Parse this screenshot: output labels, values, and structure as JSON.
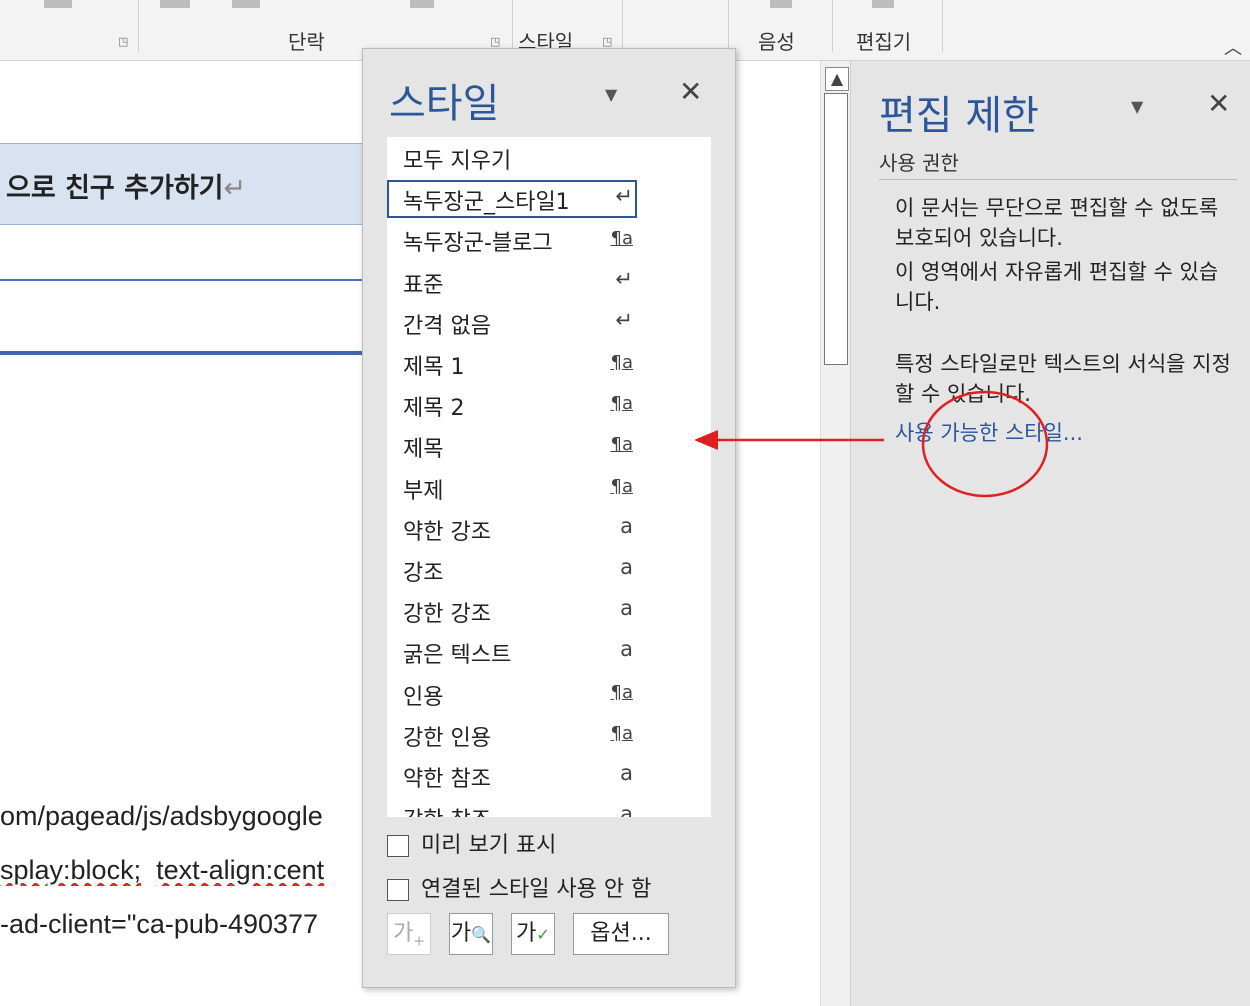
{
  "ribbon": {
    "groups": [
      {
        "label": "단락"
      },
      {
        "label": "스타일"
      },
      {
        "label": "음성"
      },
      {
        "label": "편집기"
      }
    ],
    "collapse_icon": "chevron-up-icon"
  },
  "document": {
    "heading_text": "으로 친구 추가하기",
    "para_mark": "↵",
    "code_lines": [
      "om/pagead/js/adsbygoogle",
      "splay:block;  text-align:cent",
      "-ad-client=\"ca-pub-490377"
    ],
    "squiggle_words": [
      "splay:block;",
      "text-align:cent"
    ]
  },
  "styles_pane": {
    "title": "스타일",
    "items": [
      {
        "name": "모두 지우기",
        "icon": ""
      },
      {
        "name": "녹두장군_스타일1",
        "icon": "↵",
        "selected": true
      },
      {
        "name": "녹두장군-블로그",
        "icon": "¶a"
      },
      {
        "name": "표준",
        "icon": "↵"
      },
      {
        "name": "간격 없음",
        "icon": "↵"
      },
      {
        "name": "제목 1",
        "icon": "¶a"
      },
      {
        "name": "제목 2",
        "icon": "¶a"
      },
      {
        "name": "제목",
        "icon": "¶a"
      },
      {
        "name": "부제",
        "icon": "¶a"
      },
      {
        "name": "약한 강조",
        "icon": "a"
      },
      {
        "name": "강조",
        "icon": "a"
      },
      {
        "name": "강한 강조",
        "icon": "a"
      },
      {
        "name": "굵은 텍스트",
        "icon": "a"
      },
      {
        "name": "인용",
        "icon": "¶a"
      },
      {
        "name": "강한 인용",
        "icon": "¶a"
      },
      {
        "name": "약한 참조",
        "icon": "a"
      },
      {
        "name": "강한 참조",
        "icon": "a"
      }
    ],
    "show_preview_label": "미리 보기 표시",
    "disable_linked_label": "연결된 스타일 사용 안 함",
    "options_label": "옵션..."
  },
  "restrict_pane": {
    "title": "편집 제한",
    "section_label": "사용 권한",
    "text1": "이 문서는 무단으로 편집할 수 없도록 보호되어 있습니다.",
    "text2": "이 영역에서 자유롭게 편집할 수 있습니다.",
    "text3": "특정 스타일로만 텍스트의 서식을 지정할 수 있습니다.",
    "link": "사용 가능한 스타일..."
  },
  "colors": {
    "accent": "#2b579a",
    "annotation": "#e02020"
  }
}
